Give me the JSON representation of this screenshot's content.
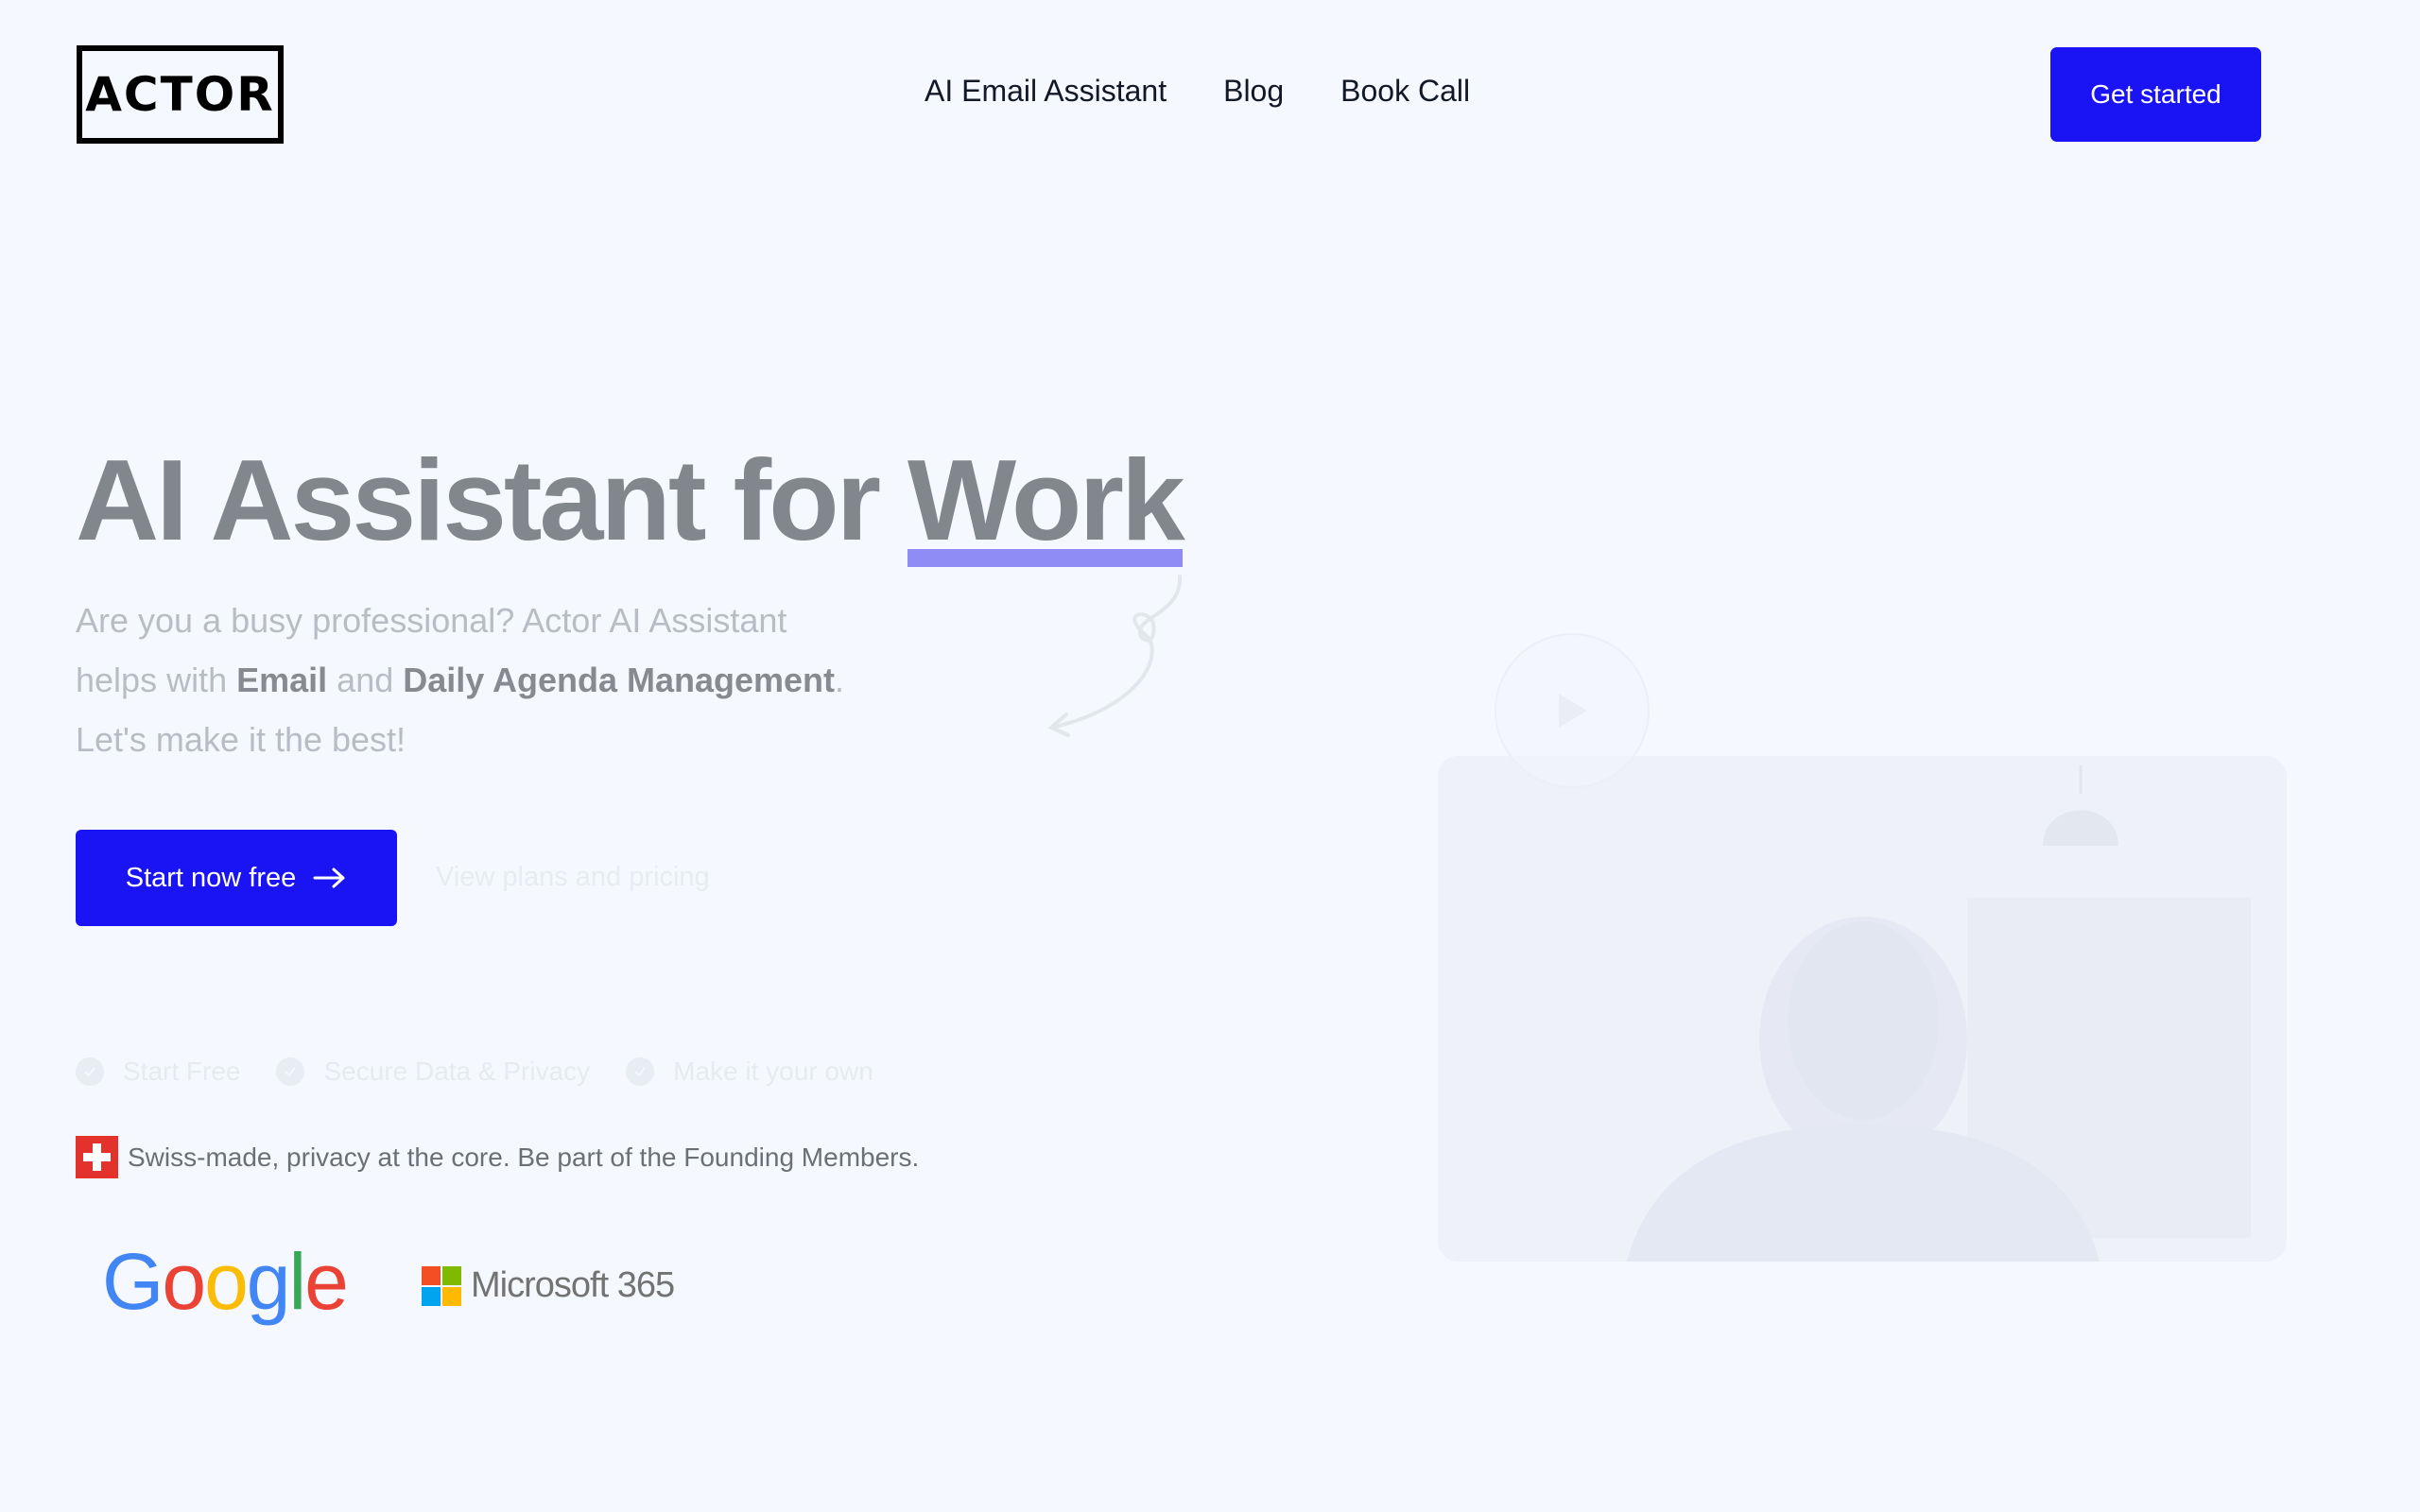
{
  "header": {
    "logo_text": "ACTOR",
    "nav": [
      {
        "label": "AI Email Assistant"
      },
      {
        "label": "Blog"
      },
      {
        "label": "Book Call"
      }
    ],
    "cta_label": "Get started"
  },
  "hero": {
    "title_prefix": "AI Assistant for",
    "title_highlight": "Work",
    "sub_line1": "Are you a busy professional? Actor AI Assistant",
    "sub_line2_a": "helps with",
    "sub_line2_email": "Email",
    "sub_line2_and": "and",
    "sub_line2_agenda": "Daily Agenda Management",
    "sub_line2_end": ".",
    "sub_line3": "Let's make it the best!",
    "primary_cta": "Start now free",
    "secondary_cta": "View plans and pricing",
    "features": [
      {
        "label": "Start Free"
      },
      {
        "label": "Secure Data & Privacy"
      },
      {
        "label": "Make it your own"
      }
    ],
    "swiss_note": "Swiss-made, privacy at the core. Be part of the Founding Members."
  },
  "partners": {
    "google": "Google",
    "microsoft": "Microsoft 365"
  },
  "colors": {
    "brand": "#1a14f4",
    "highlight_underline": "#8f8cf5",
    "background": "#f5f8fe"
  },
  "icons": {
    "arrow": "arrow-right-icon",
    "check": "check-circle-icon",
    "play": "play-icon",
    "flag": "swiss-flag-icon"
  }
}
